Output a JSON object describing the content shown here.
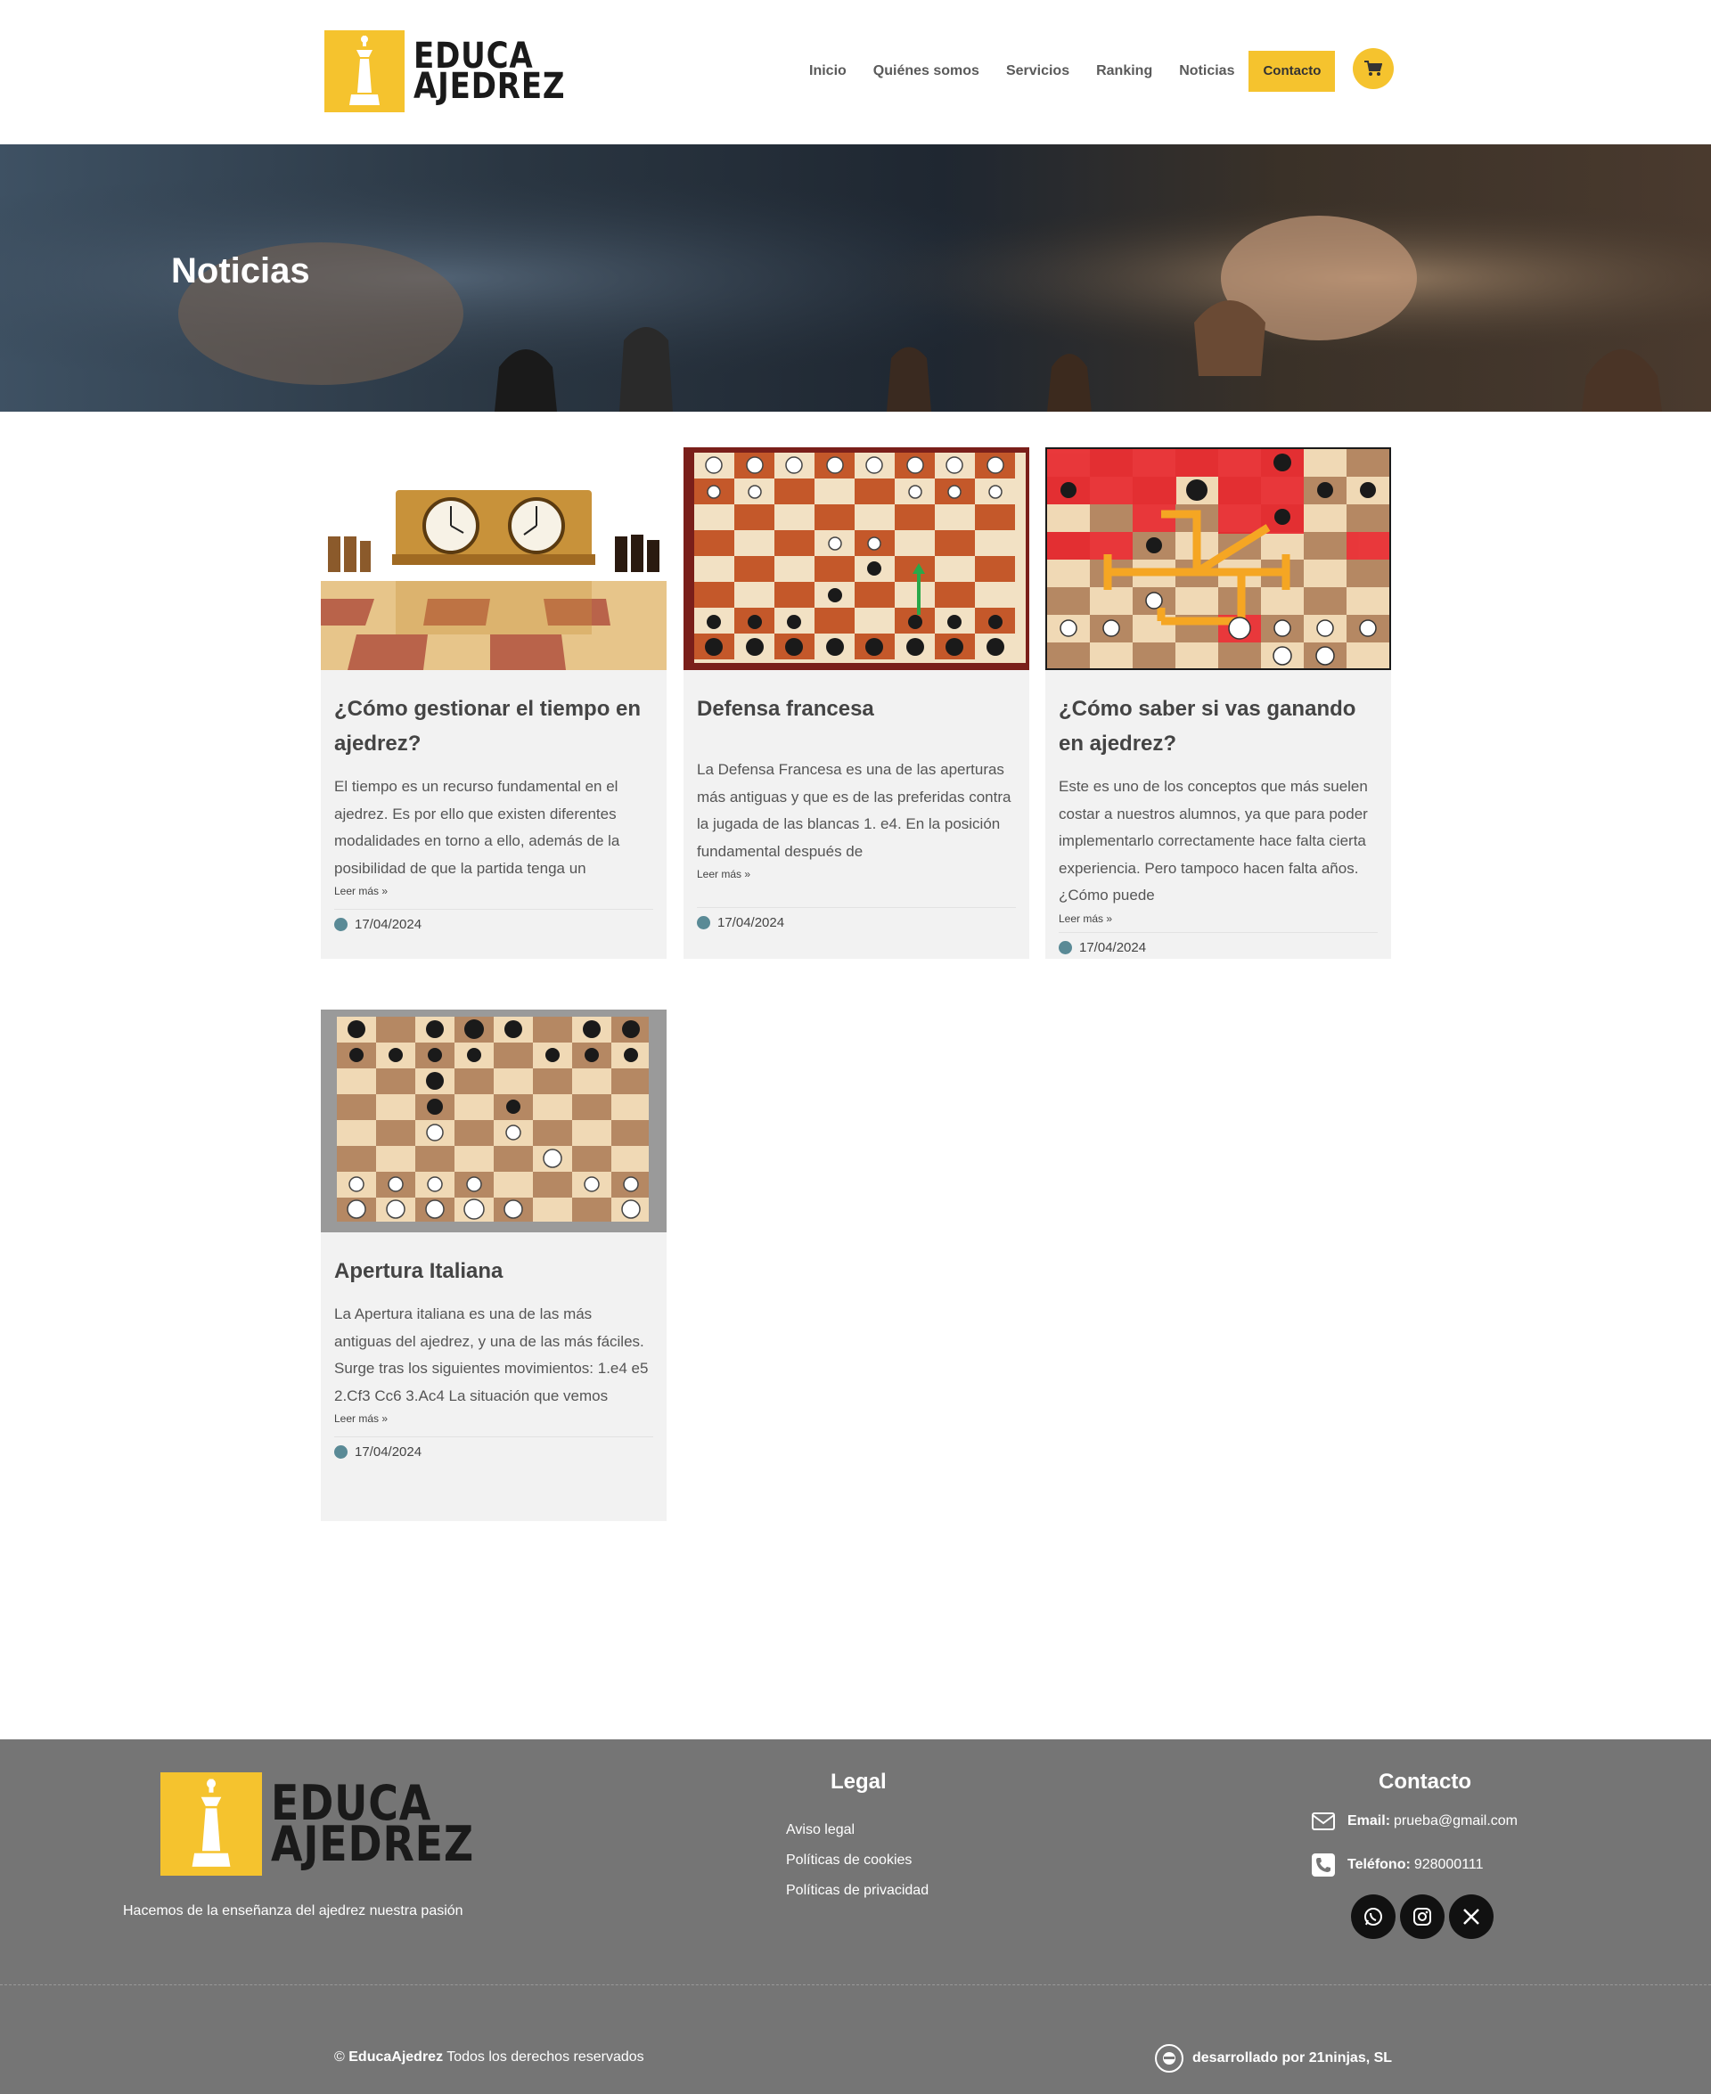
{
  "header": {
    "logo_line1": "EDUCA",
    "logo_line2": "AJEDREZ",
    "nav": [
      "Inicio",
      "Quiénes somos",
      "Servicios",
      "Ranking",
      "Noticias"
    ],
    "contact_label": "Contacto",
    "cart_icon": "cart-icon"
  },
  "hero": {
    "title": "Noticias"
  },
  "posts": [
    {
      "title": "¿Cómo gestionar el tiempo en ajedrez?",
      "excerpt": "El tiempo es un recurso fundamental en el ajedrez. Es por ello que existen diferentes modalidades en torno a ello, además de la posibilidad de que la partida tenga un",
      "more": "Leer más »",
      "date": "17/04/2024"
    },
    {
      "title": "Defensa francesa",
      "excerpt": "La Defensa Francesa es una de las aperturas más antiguas y que es de las preferidas contra la jugada de las blancas 1. e4.  En la posición fundamental después de",
      "more": "Leer más »",
      "date": "17/04/2024"
    },
    {
      "title": "¿Cómo saber si vas ganando en ajedrez?",
      "excerpt": "Este es uno de los conceptos que más suelen costar a nuestros alumnos, ya que para poder implementarlo correctamente hace falta cierta experiencia. Pero tampoco hacen falta años. ¿Cómo puede",
      "more": "Leer más »",
      "date": "17/04/2024"
    },
    {
      "title": "Apertura Italiana",
      "excerpt": "La Apertura italiana es una de las más antiguas del ajedrez, y una de las más fáciles. Surge tras los siguientes movimientos: 1.e4 e5 2.Cf3 Cc6 3.Ac4 La situación que vemos",
      "more": "Leer más »",
      "date": "17/04/2024"
    }
  ],
  "footer": {
    "logo_line1": "EDUCA",
    "logo_line2": "AJEDREZ",
    "tagline": "Hacemos de la enseñanza del ajedrez nuestra pasión",
    "legal_heading": "Legal",
    "legal_links": [
      "Aviso legal",
      "Políticas de cookies",
      "Políticas de privacidad"
    ],
    "contact_heading": "Contacto",
    "email_label": "Email:",
    "email": "prueba@gmail.com",
    "phone_label": "Teléfono:",
    "phone": "928000111",
    "social": [
      "whatsapp-icon",
      "instagram-icon",
      "x-icon"
    ],
    "copyright_symbol": "©",
    "copyright_brand": "EducaAjedrez",
    "copyright_text": "Todos los derechos reservados",
    "developer": "desarrollado por 21ninjas, SL"
  },
  "colors": {
    "accent": "#f5c32e",
    "footer_bg": "#757575",
    "card_bg": "#f2f2f2"
  }
}
